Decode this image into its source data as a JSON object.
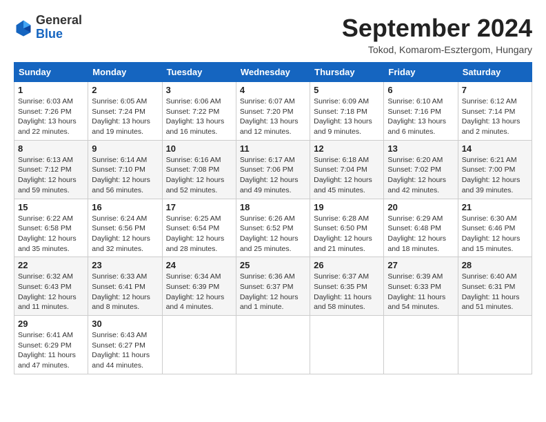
{
  "header": {
    "logo": {
      "general": "General",
      "blue": "Blue"
    },
    "title": "September 2024",
    "subtitle": "Tokod, Komarom-Esztergom, Hungary"
  },
  "calendar": {
    "days_of_week": [
      "Sunday",
      "Monday",
      "Tuesday",
      "Wednesday",
      "Thursday",
      "Friday",
      "Saturday"
    ],
    "weeks": [
      [
        {
          "day": "1",
          "detail": "Sunrise: 6:03 AM\nSunset: 7:26 PM\nDaylight: 13 hours\nand 22 minutes."
        },
        {
          "day": "2",
          "detail": "Sunrise: 6:05 AM\nSunset: 7:24 PM\nDaylight: 13 hours\nand 19 minutes."
        },
        {
          "day": "3",
          "detail": "Sunrise: 6:06 AM\nSunset: 7:22 PM\nDaylight: 13 hours\nand 16 minutes."
        },
        {
          "day": "4",
          "detail": "Sunrise: 6:07 AM\nSunset: 7:20 PM\nDaylight: 13 hours\nand 12 minutes."
        },
        {
          "day": "5",
          "detail": "Sunrise: 6:09 AM\nSunset: 7:18 PM\nDaylight: 13 hours\nand 9 minutes."
        },
        {
          "day": "6",
          "detail": "Sunrise: 6:10 AM\nSunset: 7:16 PM\nDaylight: 13 hours\nand 6 minutes."
        },
        {
          "day": "7",
          "detail": "Sunrise: 6:12 AM\nSunset: 7:14 PM\nDaylight: 13 hours\nand 2 minutes."
        }
      ],
      [
        {
          "day": "8",
          "detail": "Sunrise: 6:13 AM\nSunset: 7:12 PM\nDaylight: 12 hours\nand 59 minutes."
        },
        {
          "day": "9",
          "detail": "Sunrise: 6:14 AM\nSunset: 7:10 PM\nDaylight: 12 hours\nand 56 minutes."
        },
        {
          "day": "10",
          "detail": "Sunrise: 6:16 AM\nSunset: 7:08 PM\nDaylight: 12 hours\nand 52 minutes."
        },
        {
          "day": "11",
          "detail": "Sunrise: 6:17 AM\nSunset: 7:06 PM\nDaylight: 12 hours\nand 49 minutes."
        },
        {
          "day": "12",
          "detail": "Sunrise: 6:18 AM\nSunset: 7:04 PM\nDaylight: 12 hours\nand 45 minutes."
        },
        {
          "day": "13",
          "detail": "Sunrise: 6:20 AM\nSunset: 7:02 PM\nDaylight: 12 hours\nand 42 minutes."
        },
        {
          "day": "14",
          "detail": "Sunrise: 6:21 AM\nSunset: 7:00 PM\nDaylight: 12 hours\nand 39 minutes."
        }
      ],
      [
        {
          "day": "15",
          "detail": "Sunrise: 6:22 AM\nSunset: 6:58 PM\nDaylight: 12 hours\nand 35 minutes."
        },
        {
          "day": "16",
          "detail": "Sunrise: 6:24 AM\nSunset: 6:56 PM\nDaylight: 12 hours\nand 32 minutes."
        },
        {
          "day": "17",
          "detail": "Sunrise: 6:25 AM\nSunset: 6:54 PM\nDaylight: 12 hours\nand 28 minutes."
        },
        {
          "day": "18",
          "detail": "Sunrise: 6:26 AM\nSunset: 6:52 PM\nDaylight: 12 hours\nand 25 minutes."
        },
        {
          "day": "19",
          "detail": "Sunrise: 6:28 AM\nSunset: 6:50 PM\nDaylight: 12 hours\nand 21 minutes."
        },
        {
          "day": "20",
          "detail": "Sunrise: 6:29 AM\nSunset: 6:48 PM\nDaylight: 12 hours\nand 18 minutes."
        },
        {
          "day": "21",
          "detail": "Sunrise: 6:30 AM\nSunset: 6:46 PM\nDaylight: 12 hours\nand 15 minutes."
        }
      ],
      [
        {
          "day": "22",
          "detail": "Sunrise: 6:32 AM\nSunset: 6:43 PM\nDaylight: 12 hours\nand 11 minutes."
        },
        {
          "day": "23",
          "detail": "Sunrise: 6:33 AM\nSunset: 6:41 PM\nDaylight: 12 hours\nand 8 minutes."
        },
        {
          "day": "24",
          "detail": "Sunrise: 6:34 AM\nSunset: 6:39 PM\nDaylight: 12 hours\nand 4 minutes."
        },
        {
          "day": "25",
          "detail": "Sunrise: 6:36 AM\nSunset: 6:37 PM\nDaylight: 12 hours\nand 1 minute."
        },
        {
          "day": "26",
          "detail": "Sunrise: 6:37 AM\nSunset: 6:35 PM\nDaylight: 11 hours\nand 58 minutes."
        },
        {
          "day": "27",
          "detail": "Sunrise: 6:39 AM\nSunset: 6:33 PM\nDaylight: 11 hours\nand 54 minutes."
        },
        {
          "day": "28",
          "detail": "Sunrise: 6:40 AM\nSunset: 6:31 PM\nDaylight: 11 hours\nand 51 minutes."
        }
      ],
      [
        {
          "day": "29",
          "detail": "Sunrise: 6:41 AM\nSunset: 6:29 PM\nDaylight: 11 hours\nand 47 minutes."
        },
        {
          "day": "30",
          "detail": "Sunrise: 6:43 AM\nSunset: 6:27 PM\nDaylight: 11 hours\nand 44 minutes."
        },
        {
          "day": "",
          "detail": ""
        },
        {
          "day": "",
          "detail": ""
        },
        {
          "day": "",
          "detail": ""
        },
        {
          "day": "",
          "detail": ""
        },
        {
          "day": "",
          "detail": ""
        }
      ]
    ]
  }
}
